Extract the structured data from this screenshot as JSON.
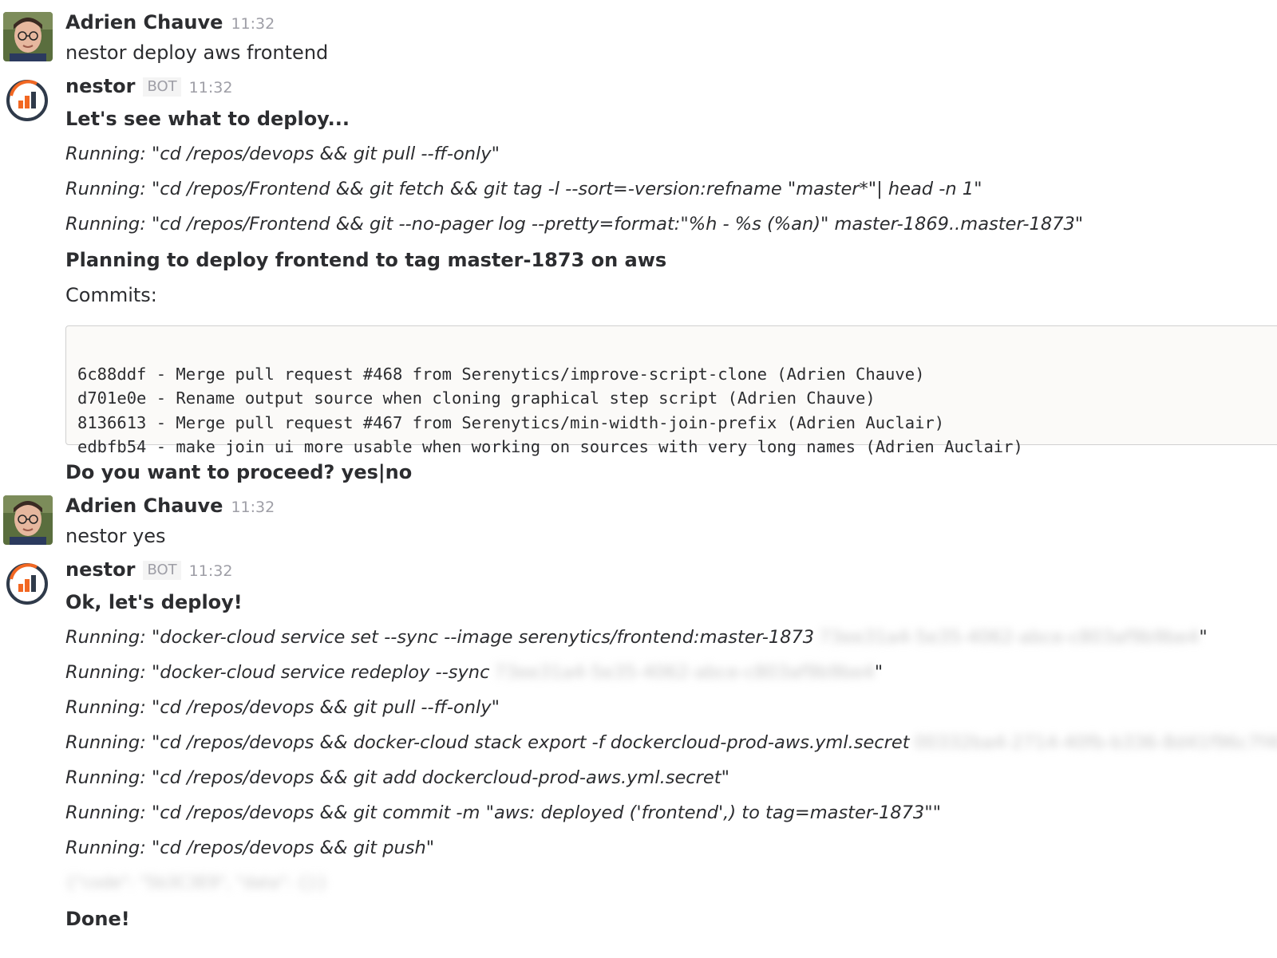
{
  "messages": [
    {
      "author": "Adrien Chauve",
      "time": "11:32",
      "text": "nestor deploy aws frontend"
    },
    {
      "author": "nestor",
      "badge": "BOT",
      "time": "11:32",
      "title": "Let's see what to deploy...",
      "commands": [
        "Running: \"cd /repos/devops && git pull --ff-only\"",
        "Running: \"cd /repos/Frontend && git fetch && git tag -l --sort=-version:refname \"master*\"| head -n 1\"",
        "Running: \"cd /repos/Frontend && git --no-pager log --pretty=format:\"%h - %s (%an)\" master-1869..master-1873\""
      ],
      "plan": "Planning to deploy frontend to tag master-1873 on aws",
      "commits_label": "Commits:",
      "commits": [
        "6c88ddf - Merge pull request #468 from Serenytics/improve-script-clone (Adrien Chauve)",
        "d701e0e - Rename output source when cloning graphical step script (Adrien Chauve)",
        "8136613 - Merge pull request #467 from Serenytics/min-width-join-prefix (Adrien Auclair)",
        "edbfb54 - make join ui more usable when working on sources with very long names (Adrien Auclair)"
      ],
      "question": "Do you want to proceed? yes|no"
    },
    {
      "author": "Adrien Chauve",
      "time": "11:32",
      "text": "nestor yes"
    },
    {
      "author": "nestor",
      "badge": "BOT",
      "time": "11:32",
      "title": "Ok, let's deploy!",
      "commands": [
        {
          "text": "Running: \"docker-cloud service set --sync --image serenytics/frontend:master-1873",
          "redacted": "73ee31a4-5e35-4062-abce-c803af9b9be4",
          "suffix": "\""
        },
        {
          "text": "Running: \"docker-cloud service redeploy --sync",
          "redacted": "73ee31a4-5e35-4062-abce-c803af9b9be4",
          "suffix": "\""
        },
        {
          "text": "Running: \"cd /repos/devops && git pull --ff-only\""
        },
        {
          "text": "Running: \"cd /repos/devops && docker-cloud stack export -f dockercloud-prod-aws.yml.secret",
          "redacted": "00332ba4-2714-40fb-b336-8d41f96c7f400",
          "suffix": "\""
        },
        {
          "text": "Running: \"cd /repos/devops && git add dockercloud-prod-aws.yml.secret\""
        },
        {
          "text": "Running: \"cd /repos/devops && git commit -m \"aws: deployed ('frontend',) to tag=master-1873\"\""
        },
        {
          "text": "Running: \"cd /repos/devops && git push\""
        }
      ],
      "redacted_result": "{\"code\": \"5b3C3E9\", \"data\": {}}",
      "done": "Done!"
    }
  ]
}
